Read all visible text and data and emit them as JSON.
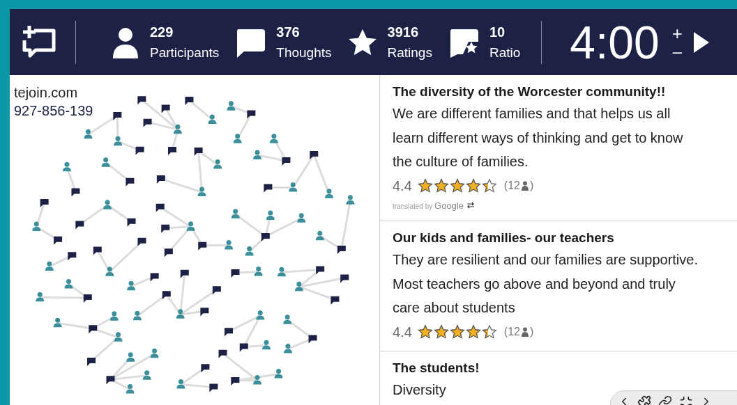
{
  "header": {
    "stats": [
      {
        "kind": "participants",
        "value": "229",
        "label": "Participants"
      },
      {
        "kind": "thoughts",
        "value": "376",
        "label": "Thoughts"
      },
      {
        "kind": "ratings",
        "value": "3916",
        "label": "Ratings"
      },
      {
        "kind": "ratio",
        "value": "10",
        "label": "Ratio"
      }
    ],
    "timer": "4:00",
    "timer_up": "+",
    "timer_down": "–"
  },
  "session": {
    "site": "tejoin.com",
    "code": "927-856-139"
  },
  "thoughts": [
    {
      "title": "The diversity of the Worcester community!!",
      "body": "We are different families and that helps us all learn different ways of thinking and get to know the culture of families.",
      "rating": "4.4",
      "stars": 4.4,
      "count": "(12",
      "count_end": ")",
      "translation": {
        "prefix": "translated by",
        "brand": "Google"
      }
    },
    {
      "title": "Our kids and families- our teachers",
      "body": "They are resilient and our families are supportive. Most teachers go above and beyond and truly care about students",
      "rating": "4.4",
      "stars": 4.4,
      "count": "(12",
      "count_end": ")"
    },
    {
      "title": "The students!",
      "body": "Diversity"
    }
  ]
}
